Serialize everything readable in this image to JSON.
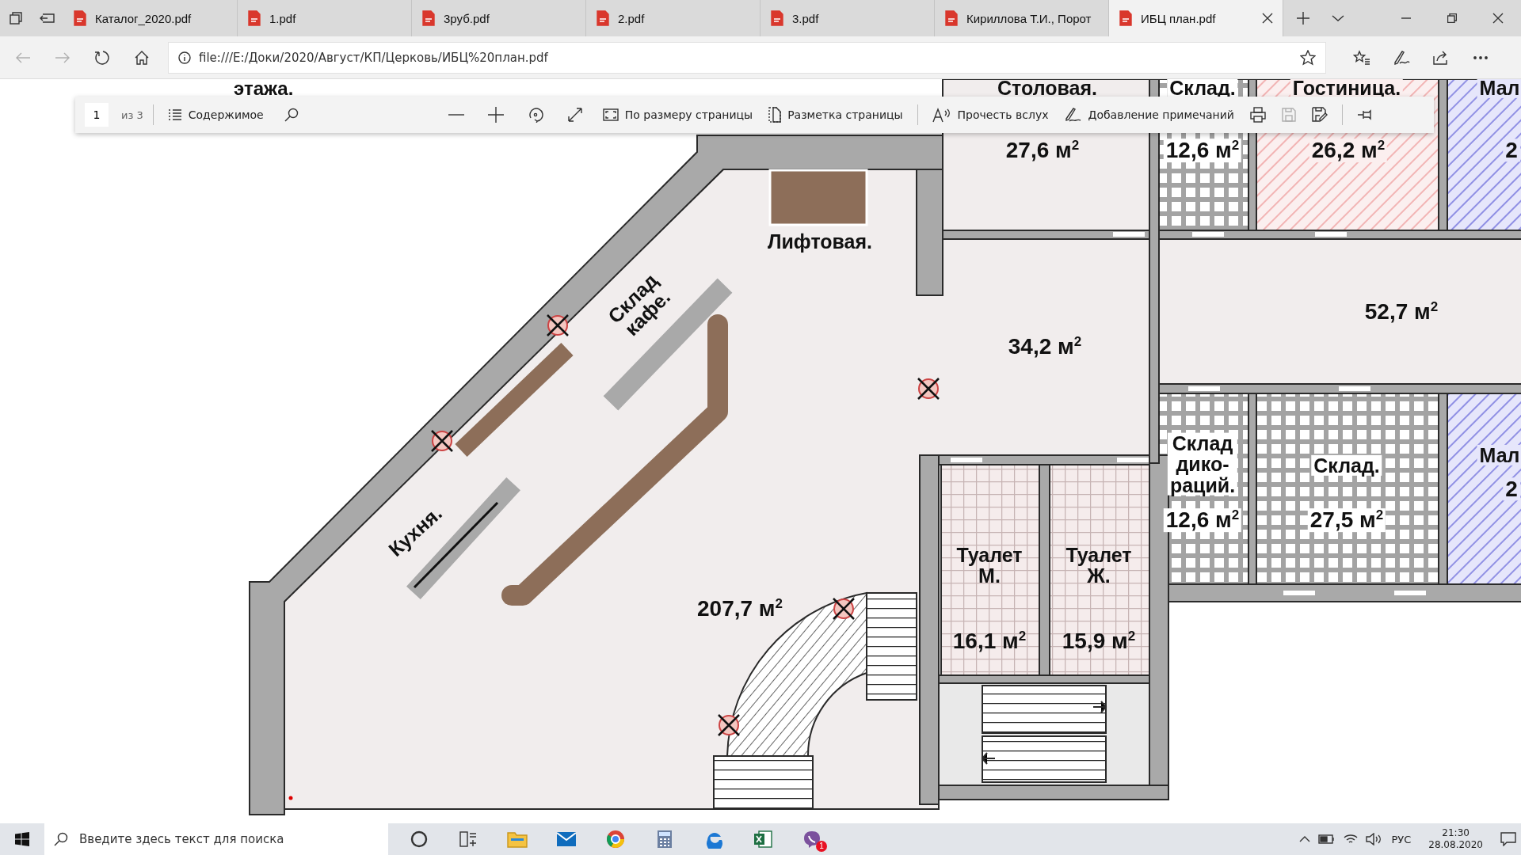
{
  "tabs": [
    {
      "label": "Каталог_2020.pdf",
      "selected": false
    },
    {
      "label": "1.pdf",
      "selected": false
    },
    {
      "label": "3руб.pdf",
      "selected": false
    },
    {
      "label": "2.pdf",
      "selected": false
    },
    {
      "label": "3.pdf",
      "selected": false
    },
    {
      "label": "Кириллова Т.И., Порот",
      "selected": false
    },
    {
      "label": "ИБЦ план.pdf",
      "selected": true
    }
  ],
  "nav": [
    {
      "kind": "back",
      "disabled": true
    },
    {
      "kind": "forward",
      "disabled": true
    },
    {
      "kind": "refresh",
      "disabled": false
    },
    {
      "kind": "home",
      "disabled": false
    }
  ],
  "address": {
    "url": "file:///E:/Доки/2020/Август/КП/Церковь/ИБЦ%20план.pdf"
  },
  "pdf_toolbar": {
    "page_number": "1",
    "page_total": "из 3",
    "groups": [
      [
        {
          "kind": "contents",
          "label": "Содержимое",
          "disabled": false
        },
        {
          "kind": "search",
          "disabled": false
        }
      ],
      [
        {
          "kind": "zoom_out",
          "disabled": false
        },
        {
          "kind": "zoom_in",
          "disabled": false
        },
        {
          "kind": "rotate",
          "disabled": false
        },
        {
          "kind": "fullscreen",
          "disabled": false
        },
        {
          "kind": "fit_page",
          "label": "По размеру страницы",
          "disabled": false
        },
        {
          "kind": "page_layout",
          "label": "Разметка страницы",
          "disabled": false
        }
      ],
      [
        {
          "kind": "read_aloud",
          "label": "Прочесть вслух",
          "disabled": false
        },
        {
          "kind": "add_notes",
          "label": "Добавление примечаний",
          "disabled": false
        },
        {
          "kind": "print",
          "disabled": false
        },
        {
          "kind": "save",
          "disabled": true
        },
        {
          "kind": "save_as",
          "disabled": false
        }
      ],
      [
        {
          "kind": "pin",
          "disabled": false
        }
      ]
    ]
  },
  "plan": {
    "heading": "этажа.",
    "rooms": [
      {
        "name": [
          "Столовая."
        ],
        "area": "27,6 м$^{2}$"
      },
      {
        "name": [
          "Склад."
        ],
        "area": "12,6 м$^{2}$"
      },
      {
        "name": [
          "Гостиница."
        ],
        "area": "26,2 м$^{2}$"
      },
      {
        "name": [
          "Мал"
        ],
        "area": "2"
      },
      {
        "name": [
          "Лифтовая."
        ]
      },
      {
        "name": [
          "Склад",
          "кафе."
        ]
      },
      {
        "area": "34,2 м$^{2}$"
      },
      {
        "area": "52,7 м$^{2}$"
      },
      {
        "name": [
          "Склад",
          "дико-",
          "раций."
        ],
        "area": "12,6 м$^{2}$"
      },
      {
        "name": [
          "Склад."
        ],
        "area": "27,5 м$^{2}$"
      },
      {
        "name": [
          "Мал"
        ],
        "area": "2"
      },
      {
        "name": [
          "Туалет",
          "М."
        ],
        "area": "16,1 м$^{2}$"
      },
      {
        "name": [
          "Туалет",
          "Ж."
        ],
        "area": "15,9 м$^{2}$"
      },
      {
        "area": "207,7 м$^{2}$"
      },
      {
        "name": [
          "Кухня."
        ]
      }
    ]
  },
  "taskbar": {
    "search_placeholder": "Введите здесь текст для поиска",
    "app_badge": "1",
    "language": "РУС",
    "time": "21:30",
    "date": "28.08.2020"
  }
}
